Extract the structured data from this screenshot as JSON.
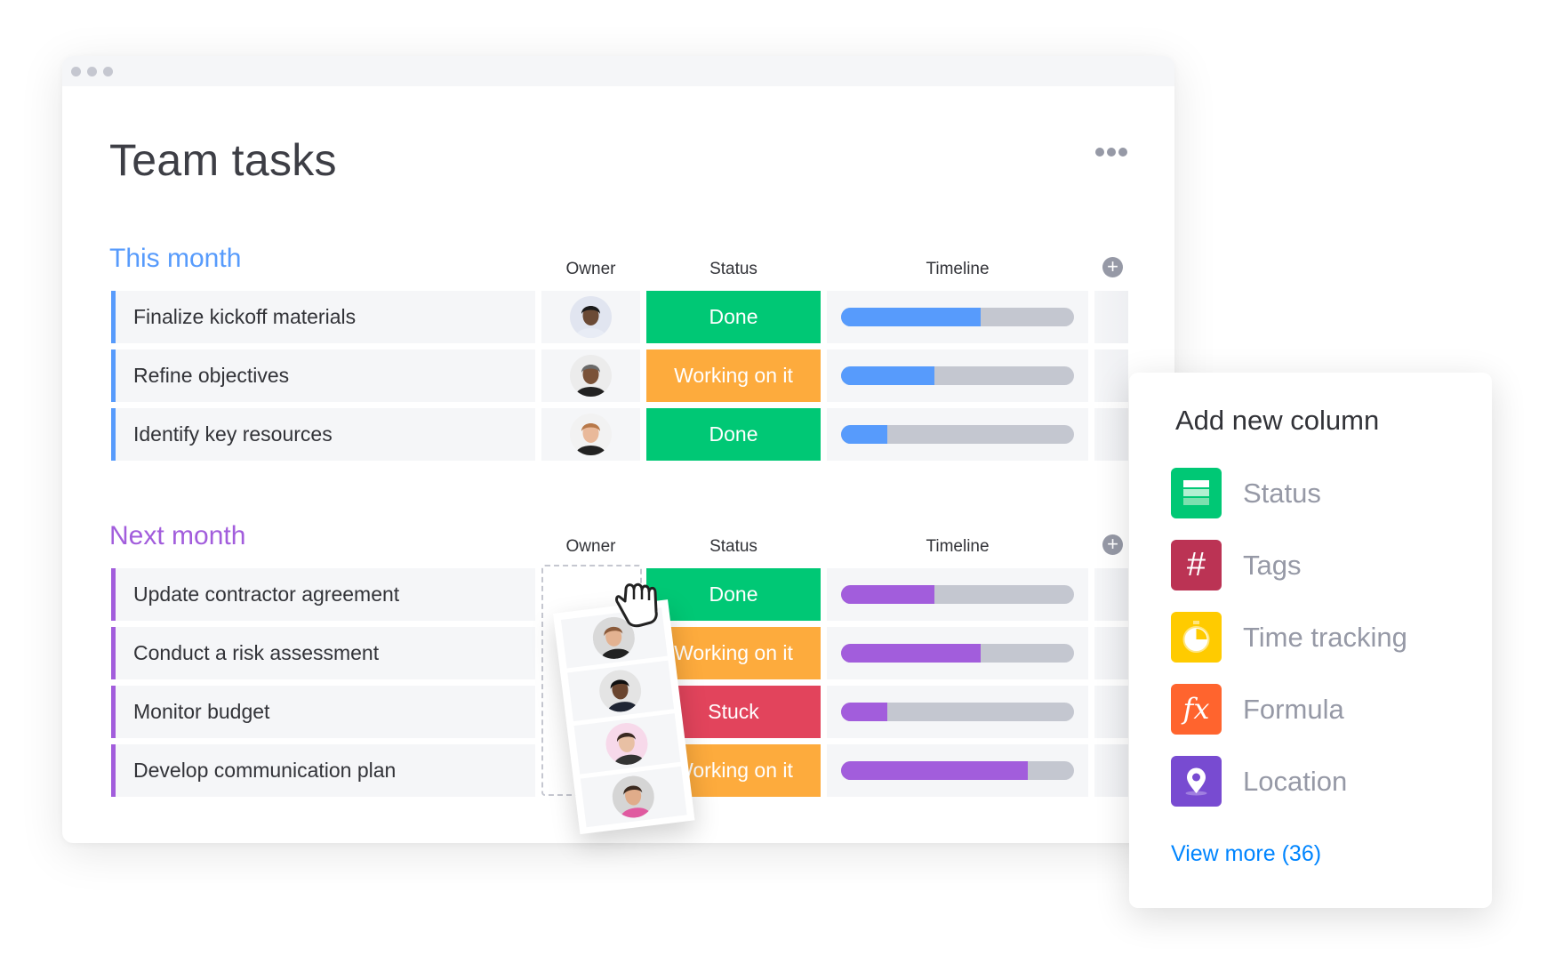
{
  "window": {
    "title": "Team tasks",
    "more_menu_icon": "more-horizontal-icon"
  },
  "columns": {
    "owner": "Owner",
    "status": "Status",
    "timeline": "Timeline",
    "add_column_icon": "plus-circle-icon"
  },
  "groups": [
    {
      "title": "This month",
      "color": "#579bfc",
      "rows": [
        {
          "task": "Finalize kickoff materials",
          "owner": "avatar-woman-glasses",
          "status": "Done",
          "status_color": "#00c875",
          "timeline_progress": 0.6
        },
        {
          "task": "Refine objectives",
          "owner": "avatar-man-cap",
          "status": "Working on it",
          "status_color": "#fdab3d",
          "timeline_progress": 0.4
        },
        {
          "task": "Identify key resources",
          "owner": "avatar-woman-popsicle",
          "status": "Done",
          "status_color": "#00c875",
          "timeline_progress": 0.2
        }
      ]
    },
    {
      "title": "Next month",
      "color": "#a25ddc",
      "rows": [
        {
          "task": "Update contractor agreement",
          "status": "Done",
          "status_color": "#00c875",
          "timeline_progress": 0.4
        },
        {
          "task": "Conduct a risk assessment",
          "status": "Working on it",
          "status_color": "#fdab3d",
          "timeline_progress": 0.6
        },
        {
          "task": "Monitor budget",
          "status": "Stuck",
          "status_color": "#e2445c",
          "timeline_progress": 0.2
        },
        {
          "task": "Develop communication plan",
          "status": "Working on it",
          "status_color": "#fdab3d",
          "timeline_progress": 0.8
        }
      ]
    }
  ],
  "drag_column": {
    "owners": [
      "avatar-man-beard-light",
      "avatar-man-beard-dark",
      "avatar-woman-dark-hair",
      "avatar-man-curly"
    ],
    "cursor_icon": "grab-hand-icon"
  },
  "add_column_panel": {
    "title": "Add new column",
    "items": [
      {
        "label": "Status",
        "icon": "status-icon",
        "color": "#00c875"
      },
      {
        "label": "Tags",
        "icon": "hashtag-icon",
        "color": "#bb3354"
      },
      {
        "label": "Time tracking",
        "icon": "stopwatch-icon",
        "color": "#ffcb00"
      },
      {
        "label": "Formula",
        "icon": "formula-icon",
        "color": "#ff642e"
      },
      {
        "label": "Location",
        "icon": "location-pin-icon",
        "color": "#784bd1"
      }
    ],
    "view_more": "View more (36)"
  }
}
